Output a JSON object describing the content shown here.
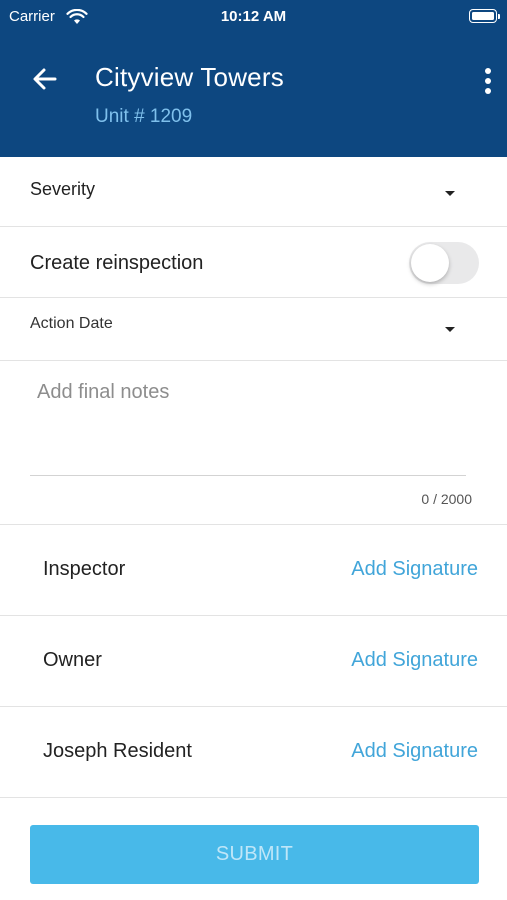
{
  "status_bar": {
    "carrier": "Carrier",
    "time": "10:12 AM",
    "wifi_icon": "wifi-icon",
    "battery_icon": "battery-icon"
  },
  "header": {
    "back_icon": "arrow-left-icon",
    "title": "Cityview Towers",
    "subtitle": "Unit # 1209",
    "more_icon": "more-vertical-icon",
    "background_color": "#0d4780",
    "subtitle_color": "#7fc0ec"
  },
  "form": {
    "severity": {
      "label": "Severity",
      "icon": "caret-down-icon"
    },
    "reinspection": {
      "label": "Create reinspection",
      "enabled": false
    },
    "action_date": {
      "label": "Action Date",
      "icon": "caret-down-icon"
    },
    "notes": {
      "placeholder": "Add final notes",
      "value": "",
      "counter": "0 / 2000"
    }
  },
  "signatures": [
    {
      "role": "Inspector",
      "action": "Add Signature"
    },
    {
      "role": "Owner",
      "action": "Add Signature"
    },
    {
      "role": "Joseph Resident",
      "action": "Add Signature"
    }
  ],
  "submit": {
    "label": "SUBMIT",
    "color": "#48b9e9"
  },
  "link_color": "#41a5d9"
}
